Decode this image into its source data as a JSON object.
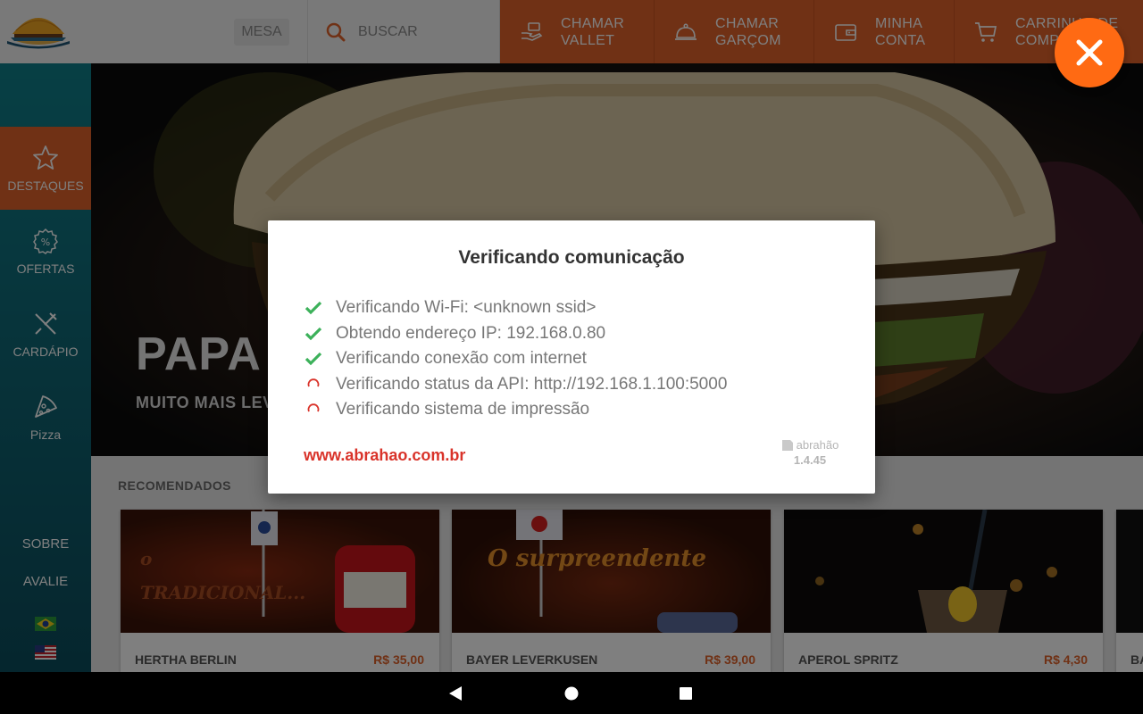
{
  "topbar": {
    "mesa_label": "MESA",
    "search_placeholder": "BUSCAR",
    "actions": [
      {
        "label": "CHAMAR\nVALLET",
        "icon": "valet-hand-icon"
      },
      {
        "label": "CHAMAR\nGARÇOM",
        "icon": "cloche-icon"
      },
      {
        "label": "MINHA\nCONTA",
        "icon": "wallet-icon"
      },
      {
        "label": "CARRINHO DE\nCOMPRAS",
        "icon": "cart-icon"
      }
    ]
  },
  "sidebar": {
    "items": [
      {
        "label": "DESTAQUES",
        "icon": "star-icon",
        "active": true
      },
      {
        "label": "OFERTAS",
        "icon": "discount-badge-icon",
        "active": false
      },
      {
        "label": "CARDÁPIO",
        "icon": "cutlery-icon",
        "active": false
      },
      {
        "label": "Pizza",
        "icon": "pizza-icon",
        "active": false
      }
    ],
    "sobre": "SOBRE",
    "avalie": "AVALIE"
  },
  "hero": {
    "title": "PAPA",
    "subtitle": "MUITO MAIS LEV"
  },
  "recommended": {
    "title": "RECOMENDADOS",
    "cards": [
      {
        "name": "HERTHA BERLIN",
        "price": "R$ 35,00",
        "overlay": "o TRADICIONAL..."
      },
      {
        "name": "BAYER LEVERKUSEN",
        "price": "R$ 39,00",
        "overlay": "O surpreendente"
      },
      {
        "name": "APEROL SPRITZ",
        "price": "R$ 4,30",
        "overlay": ""
      },
      {
        "name": "BA",
        "price": "",
        "overlay": ""
      }
    ]
  },
  "modal": {
    "title": "Verificando comunicação",
    "checks": [
      {
        "status": "done",
        "text": "Verificando Wi-Fi: <unknown ssid>"
      },
      {
        "status": "done",
        "text": "Obtendo endereço IP: 192.168.0.80"
      },
      {
        "status": "done",
        "text": "Verificando conexão com internet"
      },
      {
        "status": "loading",
        "text": "Verificando status da API: http://192.168.1.100:5000"
      },
      {
        "status": "loading",
        "text": "Verificando sistema de impressão"
      }
    ],
    "link": "www.abrahao.com.br",
    "brand": "abrahão",
    "version": "1.4.45"
  },
  "colors": {
    "accent": "#e0632b",
    "close_fab": "#ff6a13",
    "sidebar": "#0f6a78",
    "check_green": "#3cb15a",
    "link_red": "#d9332a"
  }
}
